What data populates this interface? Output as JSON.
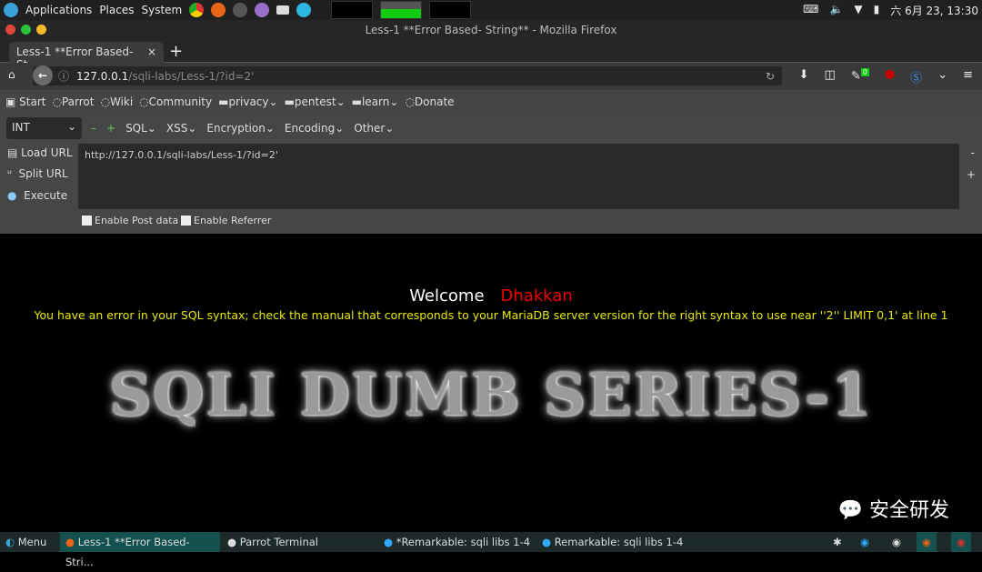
{
  "topbar": {
    "menus": [
      "Applications",
      "Places",
      "System"
    ],
    "clock": "六 6月 23, 13:30"
  },
  "window": {
    "title": "Less-1 **Error Based- String** - Mozilla Firefox"
  },
  "tab": {
    "label": "Less-1 **Error Based- St...",
    "close": "×",
    "new": "+"
  },
  "nav": {
    "url_host": "127.0.0.1",
    "url_path": "/sqli-labs/Less-1/?id=2'",
    "badge": "0"
  },
  "bookmarks": [
    "Start",
    "Parrot",
    "Wiki",
    "Community",
    "privacy",
    "pentest",
    "learn",
    "Donate"
  ],
  "hackbar": {
    "select": "INT",
    "menus": [
      "SQL",
      "XSS",
      "Encryption",
      "Encoding",
      "Other"
    ],
    "load": "Load URL",
    "split": "Split URL",
    "execute": "Execute",
    "url": "http://127.0.0.1/sqli-labs/Less-1/?id=2'",
    "post": "Enable Post data",
    "referrer": "Enable Referrer",
    "minus": "-",
    "plus": "+"
  },
  "page": {
    "welcome": "Welcome",
    "name": "Dhakkan",
    "error": "You have an error in your SQL syntax; check the manual that corresponds to your MariaDB server version for the right syntax to use near ''2'' LIMIT 0,1' at line 1",
    "logo": "SQLI DUMB SERIES-1",
    "watermark": "安全研发"
  },
  "taskbar": {
    "menu": "Menu",
    "items": [
      "Less-1 **Error Based- Stri...",
      "Parrot Terminal",
      "*Remarkable: sqli libs 1-4",
      "Remarkable: sqli libs 1-4"
    ]
  }
}
